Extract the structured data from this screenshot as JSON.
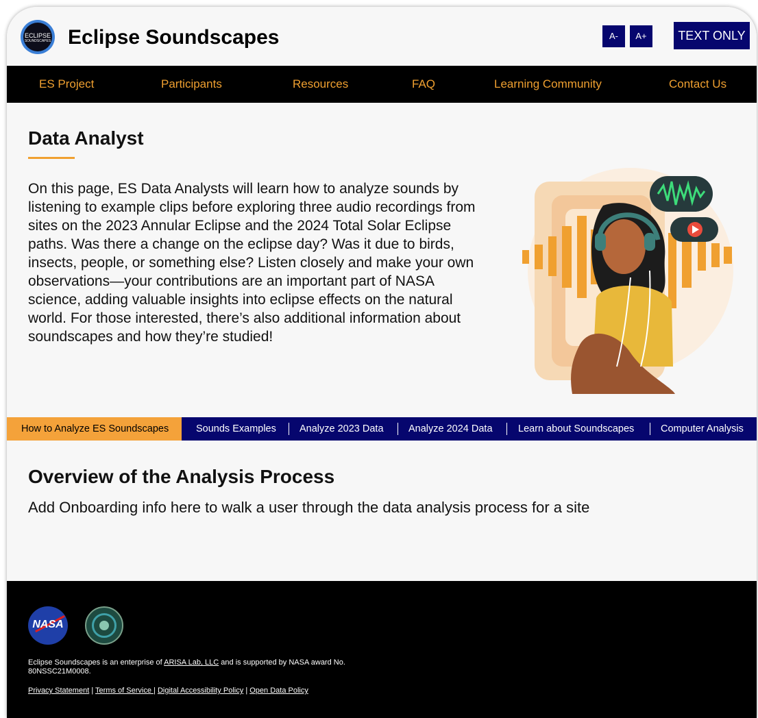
{
  "header": {
    "logo_text_1": "ECLIPSE",
    "logo_text_2": "SOUNDSCAPES",
    "title": "Eclipse Soundscapes",
    "font_smaller": "A-",
    "font_larger": "A+",
    "text_only": "TEXT ONLY"
  },
  "nav": [
    {
      "label": "ES Project"
    },
    {
      "label": "Participants"
    },
    {
      "label": "Resources"
    },
    {
      "label": "FAQ"
    },
    {
      "label": "Learning Community"
    },
    {
      "label": "Contact Us"
    }
  ],
  "hero": {
    "heading": "Data Analyst",
    "intro": "On this page, ES Data Analysts will learn how to analyze sounds by listening to example clips before exploring three audio recordings from sites on the 2023 Annular Eclipse and the 2024 Total Solar Eclipse paths. Was there a change on the eclipse day? Was it due to birds, insects, people, or something else? Listen closely and make your own observations—your contributions are an important part of NASA science, adding valuable insights into eclipse effects on the natural world. For those interested, there’s also additional information about soundscapes and how they’re studied!"
  },
  "tabs": [
    {
      "label": "How to Analyze ES Soundscapes",
      "active": true
    },
    {
      "label": "Sounds Examples"
    },
    {
      "label": "Analyze 2023 Data"
    },
    {
      "label": "Analyze 2024 Data"
    },
    {
      "label": "Learn about Soundscapes"
    },
    {
      "label": "Computer Analysis"
    }
  ],
  "overview": {
    "heading": "Overview of the Analysis Process",
    "text": "Add Onboarding info here to walk a user through the data analysis process for a site"
  },
  "footer": {
    "nasa_logo": "NASA",
    "text_before": "Eclipse Soundscapes is an enterprise of ",
    "arisa_link": "ARISA Lab, LLC",
    "text_after": " and is supported by NASA award No. 80NSSC21M0008.",
    "links": [
      "Privacy Statement",
      "Terms of Service ",
      "Digital Accessibility Policy",
      "Open Data Policy"
    ],
    "separator": " | "
  },
  "colors": {
    "accent_orange": "#f0a030",
    "navy": "#06066e",
    "nav_bg": "#000000"
  }
}
